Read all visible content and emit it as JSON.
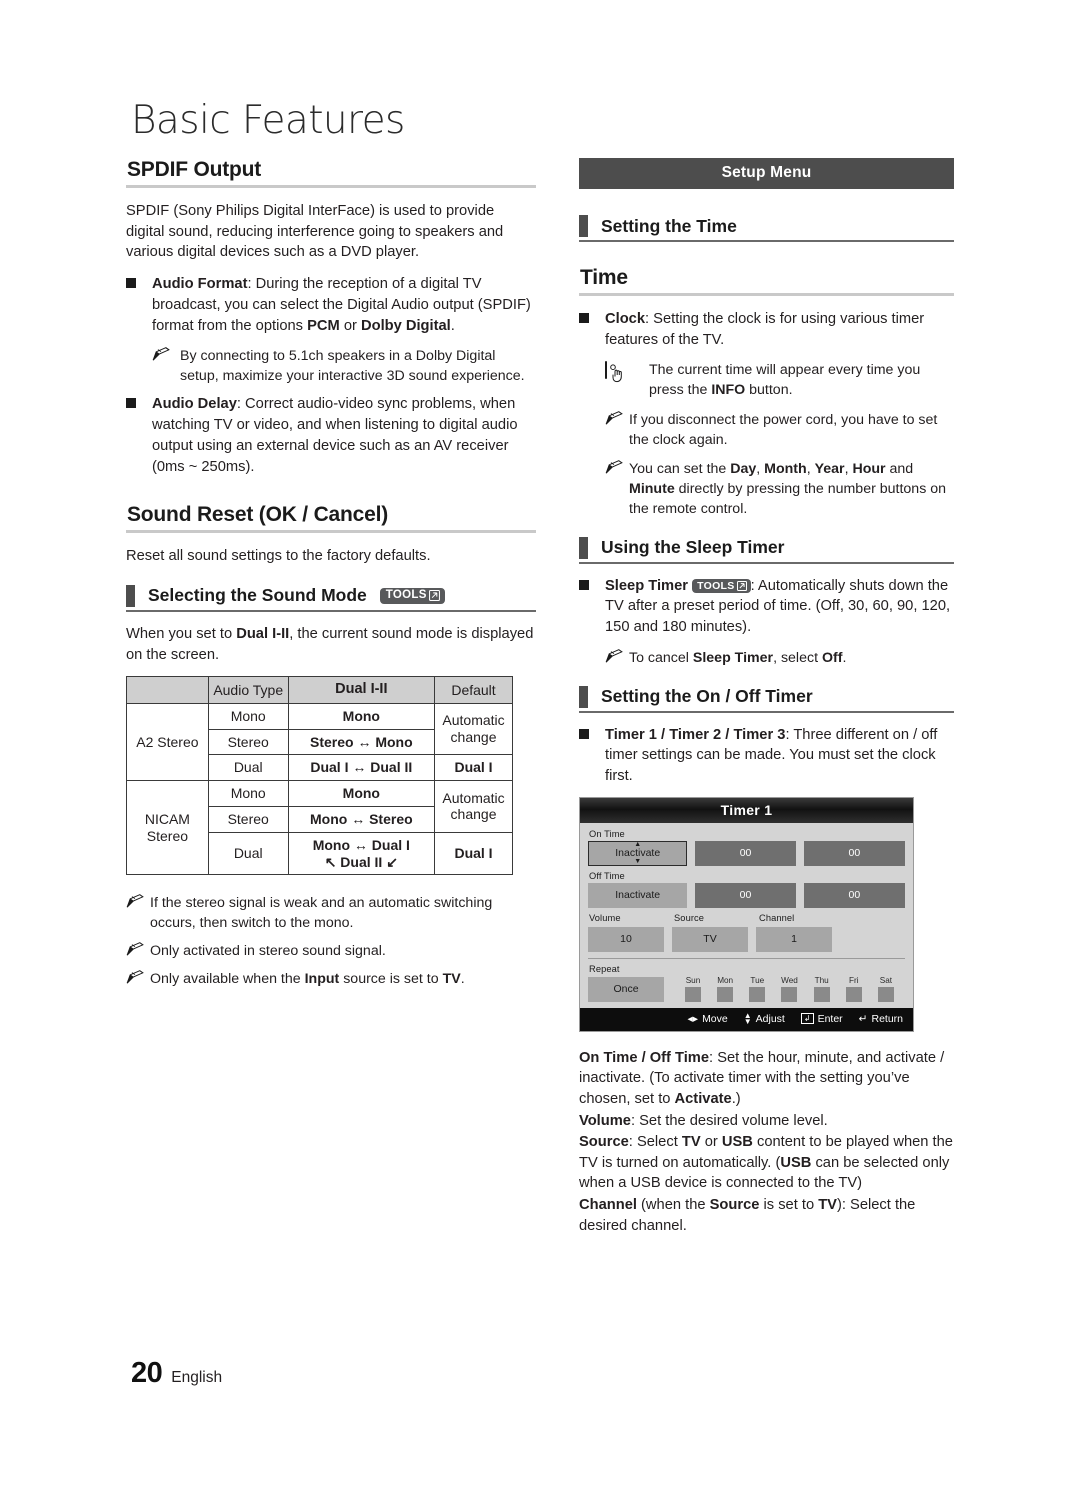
{
  "chapter": {
    "title": "Basic Features"
  },
  "footer": {
    "page_number": "20",
    "language": "English"
  },
  "left_column": {
    "spdif": {
      "heading": "SPDIF Output",
      "intro": "SPDIF (Sony Philips Digital InterFace) is used to provide digital sound, reducing interference going to speakers and various digital devices such as a DVD player.",
      "audio_format": {
        "term": "Audio Format",
        "text": ": During the reception of a digital TV broadcast, you can select the Digital Audio output (SPDIF) format from the options ",
        "option_1": "PCM",
        "between": " or ",
        "option_2": "Dolby Digital",
        "end": ".",
        "note": "By connecting to 5.1ch speakers in a Dolby Digital setup, maximize your interactive 3D sound experience."
      },
      "audio_delay": {
        "term": "Audio Delay",
        "text": ": Correct audio-video sync problems, when watching TV or video, and when listening to digital audio output using an external device such as an AV receiver (0ms ~ 250ms)."
      }
    },
    "sound_reset": {
      "heading": "Sound Reset (OK / Cancel)",
      "body": "Reset all sound settings to the factory defaults."
    },
    "sound_mode": {
      "heading": "Selecting the Sound Mode",
      "tools_badge": "TOOLS",
      "intro_a": "When you set to ",
      "intro_bold": "Dual I-II",
      "intro_b": ", the current sound mode is displayed on the screen.",
      "table": {
        "headers": [
          "",
          "Audio Type",
          "Dual I-II",
          "Default"
        ],
        "rows": [
          {
            "system": "A2 Stereo",
            "type": "Mono",
            "mode": "Mono",
            "default": "Automatic change"
          },
          {
            "system": "",
            "type": "Stereo",
            "mode": "Stereo ↔ Mono",
            "default": ""
          },
          {
            "system": "",
            "type": "Dual",
            "mode": "Dual I ↔ Dual II",
            "default": "Dual I"
          },
          {
            "system": "NICAM Stereo",
            "type": "Mono",
            "mode": "Mono",
            "default": "Automatic change"
          },
          {
            "system": "",
            "type": "Stereo",
            "mode": "Mono ↔ Stereo",
            "default": ""
          },
          {
            "system": "",
            "type": "Dual",
            "mode": "Mono ↔ Dual I",
            "mode2": "↖ Dual II ↙",
            "default": "Dual I"
          }
        ]
      },
      "notes": [
        "If the stereo signal is weak and an automatic switching occurs, then switch to the mono.",
        "Only activated in stereo sound signal."
      ],
      "note_input_a": "Only available when the ",
      "note_input_bold": "Input",
      "note_input_b": " source is set to ",
      "note_input_bold2": "TV",
      "note_input_c": "."
    }
  },
  "right_column": {
    "banner": "Setup Menu",
    "setting_the_time": {
      "heading": "Setting the Time"
    },
    "time": {
      "heading": "Time",
      "clock": {
        "term": "Clock",
        "text": ": Setting the clock is for using various timer features of the TV."
      },
      "hand_note_a": "The current time will appear every time you press the ",
      "hand_note_bold": "INFO",
      "hand_note_b": " button.",
      "note_power": "If you disconnect the power cord, you have to set the clock again.",
      "note_set_a": "You can set the ",
      "note_set_terms": [
        "Day",
        "Month",
        "Year",
        "Hour"
      ],
      "note_set_b": " and ",
      "note_set_minute": "Minute",
      "note_set_c": " directly by pressing the number buttons on the remote control."
    },
    "sleep_timer": {
      "heading": "Using the Sleep Timer",
      "term": "Sleep Timer",
      "tools_badge": "TOOLS",
      "text": ": Automatically shuts down the TV after a preset period of time. (Off, 30, 60, 90, 120, 150 and 180 minutes).",
      "note_a": "To cancel ",
      "note_bold": "Sleep Timer",
      "note_b": ", select ",
      "note_bold2": "Off",
      "note_c": "."
    },
    "on_off_timer": {
      "heading": "Setting the On / Off Timer",
      "term": "Timer 1 / Timer 2 / Timer 3",
      "text": ": Three different on / off timer settings can be made. You must set the clock first."
    },
    "timer_screen": {
      "title": "Timer 1",
      "on_time_label": "On Time",
      "on_time_value": "Inactivate",
      "on_time_hour": "00",
      "on_time_minute": "00",
      "off_time_label": "Off Time",
      "off_time_value": "Inactivate",
      "off_time_hour": "00",
      "off_time_minute": "00",
      "volume_label": "Volume",
      "volume_value": "10",
      "source_label": "Source",
      "source_value": "TV",
      "channel_label": "Channel",
      "channel_value": "1",
      "repeat_label": "Repeat",
      "repeat_value": "Once",
      "days": [
        "Sun",
        "Mon",
        "Tue",
        "Wed",
        "Thu",
        "Fri",
        "Sat"
      ],
      "footer": {
        "move": "Move",
        "adjust": "Adjust",
        "enter": "Enter",
        "return": "Return"
      }
    },
    "definitions": {
      "on_off_term": "On Time / Off Time",
      "on_off_text_a": ": Set the hour, minute, and activate / inactivate. (To activate timer with the setting you’ve chosen, set to ",
      "on_off_bold": "Activate",
      "on_off_text_b": ".)",
      "volume_term": "Volume",
      "volume_text": ": Set the desired volume level.",
      "source_term": "Source",
      "source_text_a": ": Select ",
      "source_tv": "TV",
      "source_text_b": " or ",
      "source_usb": "USB",
      "source_text_c": " content to be played when the TV is turned on automatically. (",
      "source_usb2": "USB",
      "source_text_d": " can be selected only when a USB device is connected to the TV)",
      "channel_term": "Channel",
      "channel_text_a": " (when the ",
      "channel_source": "Source",
      "channel_text_b": " is set to ",
      "channel_tv": "TV",
      "channel_text_c": "): Select the desired channel."
    }
  },
  "colors": {
    "tab": "#4d4d4d",
    "banner_bg": "#4d4d4d",
    "table_header_bg": "#cfcfcf",
    "screen_bg": "#d4d4d4",
    "screen_cell": "#a6a6a6",
    "screen_cell_dark": "#6f6f6f"
  }
}
